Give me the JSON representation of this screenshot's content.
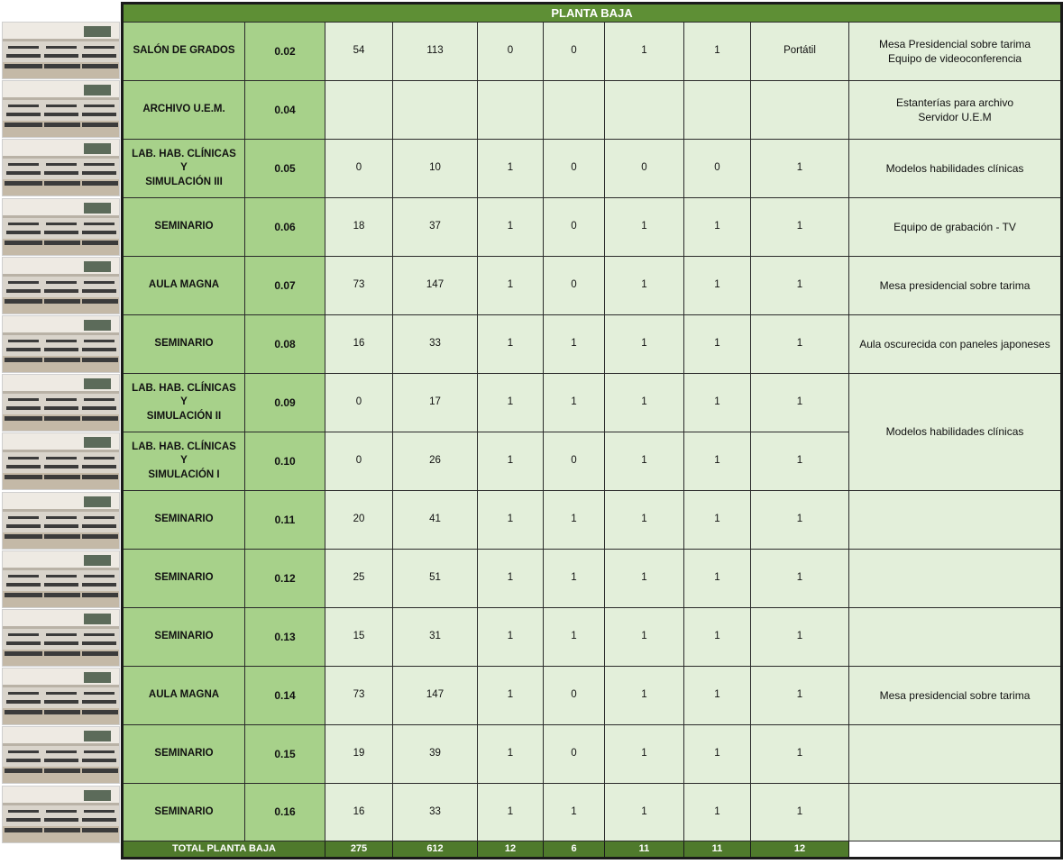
{
  "sheet": {
    "title": "PLANTA BAJA",
    "rows": [
      {
        "name": [
          "SALÓN DE GRADOS"
        ],
        "code": "0.02",
        "v": [
          "54",
          "113",
          "0",
          "0",
          "1",
          "1",
          "Portátil"
        ],
        "obs": [
          "Mesa Presidencial sobre tarima",
          "Equipo de videoconferencia"
        ],
        "photo": "auditorium-photo"
      },
      {
        "name": [
          "ARCHIVO U.E.M."
        ],
        "code": "0.04",
        "v": [
          "",
          "",
          "",
          "",
          "",
          "",
          ""
        ],
        "obs": [
          "Estanterías para archivo",
          "Servidor U.E.M"
        ],
        "photo": "archive-shelves-photo"
      },
      {
        "name": [
          "LAB. HAB. CLÍNICAS Y",
          "SIMULACIÓN III"
        ],
        "code": "0.05",
        "v": [
          "0",
          "10",
          "1",
          "0",
          "0",
          "0",
          "1"
        ],
        "obs": [
          "Modelos habilidades clínicas"
        ],
        "photo": "clinical-lab-photo"
      },
      {
        "name": [
          "SEMINARIO"
        ],
        "code": "0.06",
        "v": [
          "18",
          "37",
          "1",
          "0",
          "1",
          "1",
          "1"
        ],
        "obs": [
          "Equipo de grabación - TV"
        ],
        "photo": "seminar-room-photo"
      },
      {
        "name": [
          "AULA MAGNA"
        ],
        "code": "0.07",
        "v": [
          "73",
          "147",
          "1",
          "0",
          "1",
          "1",
          "1"
        ],
        "obs": [
          "Mesa presidencial sobre tarima"
        ],
        "photo": "lecture-hall-photo"
      },
      {
        "name": [
          "SEMINARIO"
        ],
        "code": "0.08",
        "v": [
          "16",
          "33",
          "1",
          "1",
          "1",
          "1",
          "1"
        ],
        "obs": [
          "Aula oscurecida con paneles japoneses"
        ],
        "photo": "seminar-room-photo"
      },
      {
        "name": [
          "LAB. HAB. CLÍNICAS Y",
          "SIMULACIÓN II"
        ],
        "code": "0.09",
        "v": [
          "0",
          "17",
          "1",
          "1",
          "1",
          "1",
          "1"
        ],
        "obs": [
          "Modelos habilidades clínicas"
        ],
        "photo": "clinical-lab-photo"
      },
      {
        "name": [
          "LAB. HAB. CLÍNICAS Y",
          "SIMULACIÓN I"
        ],
        "code": "0.10",
        "v": [
          "0",
          "26",
          "1",
          "0",
          "1",
          "1",
          "1"
        ],
        "obs": null,
        "photo": "clinical-lab-photo"
      },
      {
        "name": [
          "SEMINARIO"
        ],
        "code": "0.11",
        "v": [
          "20",
          "41",
          "1",
          "1",
          "1",
          "1",
          "1"
        ],
        "obs": [],
        "photo": "seminar-room-photo"
      },
      {
        "name": [
          "SEMINARIO"
        ],
        "code": "0.12",
        "v": [
          "25",
          "51",
          "1",
          "1",
          "1",
          "1",
          "1"
        ],
        "obs": [],
        "photo": "seminar-room-photo"
      },
      {
        "name": [
          "SEMINARIO"
        ],
        "code": "0.13",
        "v": [
          "15",
          "31",
          "1",
          "1",
          "1",
          "1",
          "1"
        ],
        "obs": [],
        "photo": "seminar-room-photo"
      },
      {
        "name": [
          "AULA MAGNA"
        ],
        "code": "0.14",
        "v": [
          "73",
          "147",
          "1",
          "0",
          "1",
          "1",
          "1"
        ],
        "obs": [
          "Mesa presidencial sobre tarima"
        ],
        "photo": "lecture-hall-photo"
      },
      {
        "name": [
          "SEMINARIO"
        ],
        "code": "0.15",
        "v": [
          "19",
          "39",
          "1",
          "0",
          "1",
          "1",
          "1"
        ],
        "obs": [],
        "photo": "seminar-room-photo"
      },
      {
        "name": [
          "SEMINARIO"
        ],
        "code": "0.16",
        "v": [
          "16",
          "33",
          "1",
          "1",
          "1",
          "1",
          "1"
        ],
        "obs": [],
        "photo": "seminar-room-photo"
      }
    ],
    "total": {
      "label": "TOTAL PLANTA BAJA",
      "values": [
        "275",
        "612",
        "12",
        "6",
        "11",
        "11",
        "12"
      ]
    }
  },
  "colors": {
    "title_bg": "#5e8f35",
    "name_bg": "#a7d18a",
    "cell_bg": "#e3efda",
    "total_bg": "#4f7a2c"
  }
}
